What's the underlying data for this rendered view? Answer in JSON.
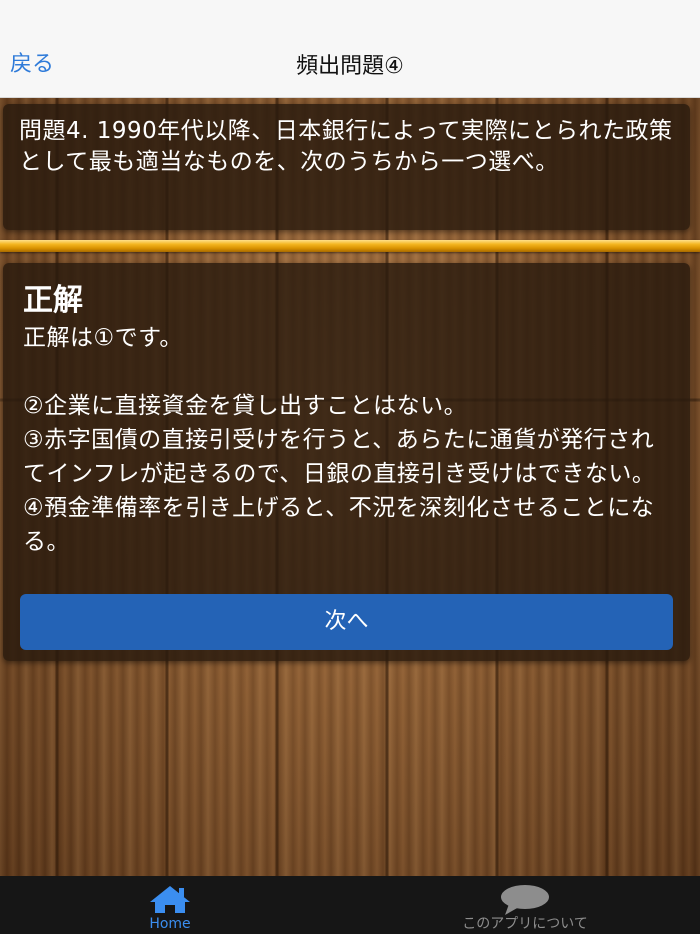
{
  "nav": {
    "back_label": "戻る",
    "title": "頻出問題④"
  },
  "question": {
    "text": "問題4. 1990年代以降、日本銀行によって実際にとられた政策として最も適当なものを、次のうちから一つ選べ。"
  },
  "answer": {
    "heading": "正解",
    "body": "正解は①です。\n\n②企業に直接資金を貸し出すことはない。\n③赤字国債の直接引受けを行うと、あらたに通貨が発行されてインフレが起きるので、日銀の直接引き受けはできない。\n④預金準備率を引き上げると、不況を深刻化させることになる。"
  },
  "next_button": {
    "label": "次へ"
  },
  "tabbar": {
    "home_label": "Home",
    "home_icon": "home-icon",
    "about_label": "このアプリについて",
    "about_icon": "speech-bubble-icon"
  },
  "colors": {
    "accent": "#2f7bd9",
    "button": "#2463b6",
    "divider": "#f4b620",
    "tab_active": "#3b8ef0"
  }
}
